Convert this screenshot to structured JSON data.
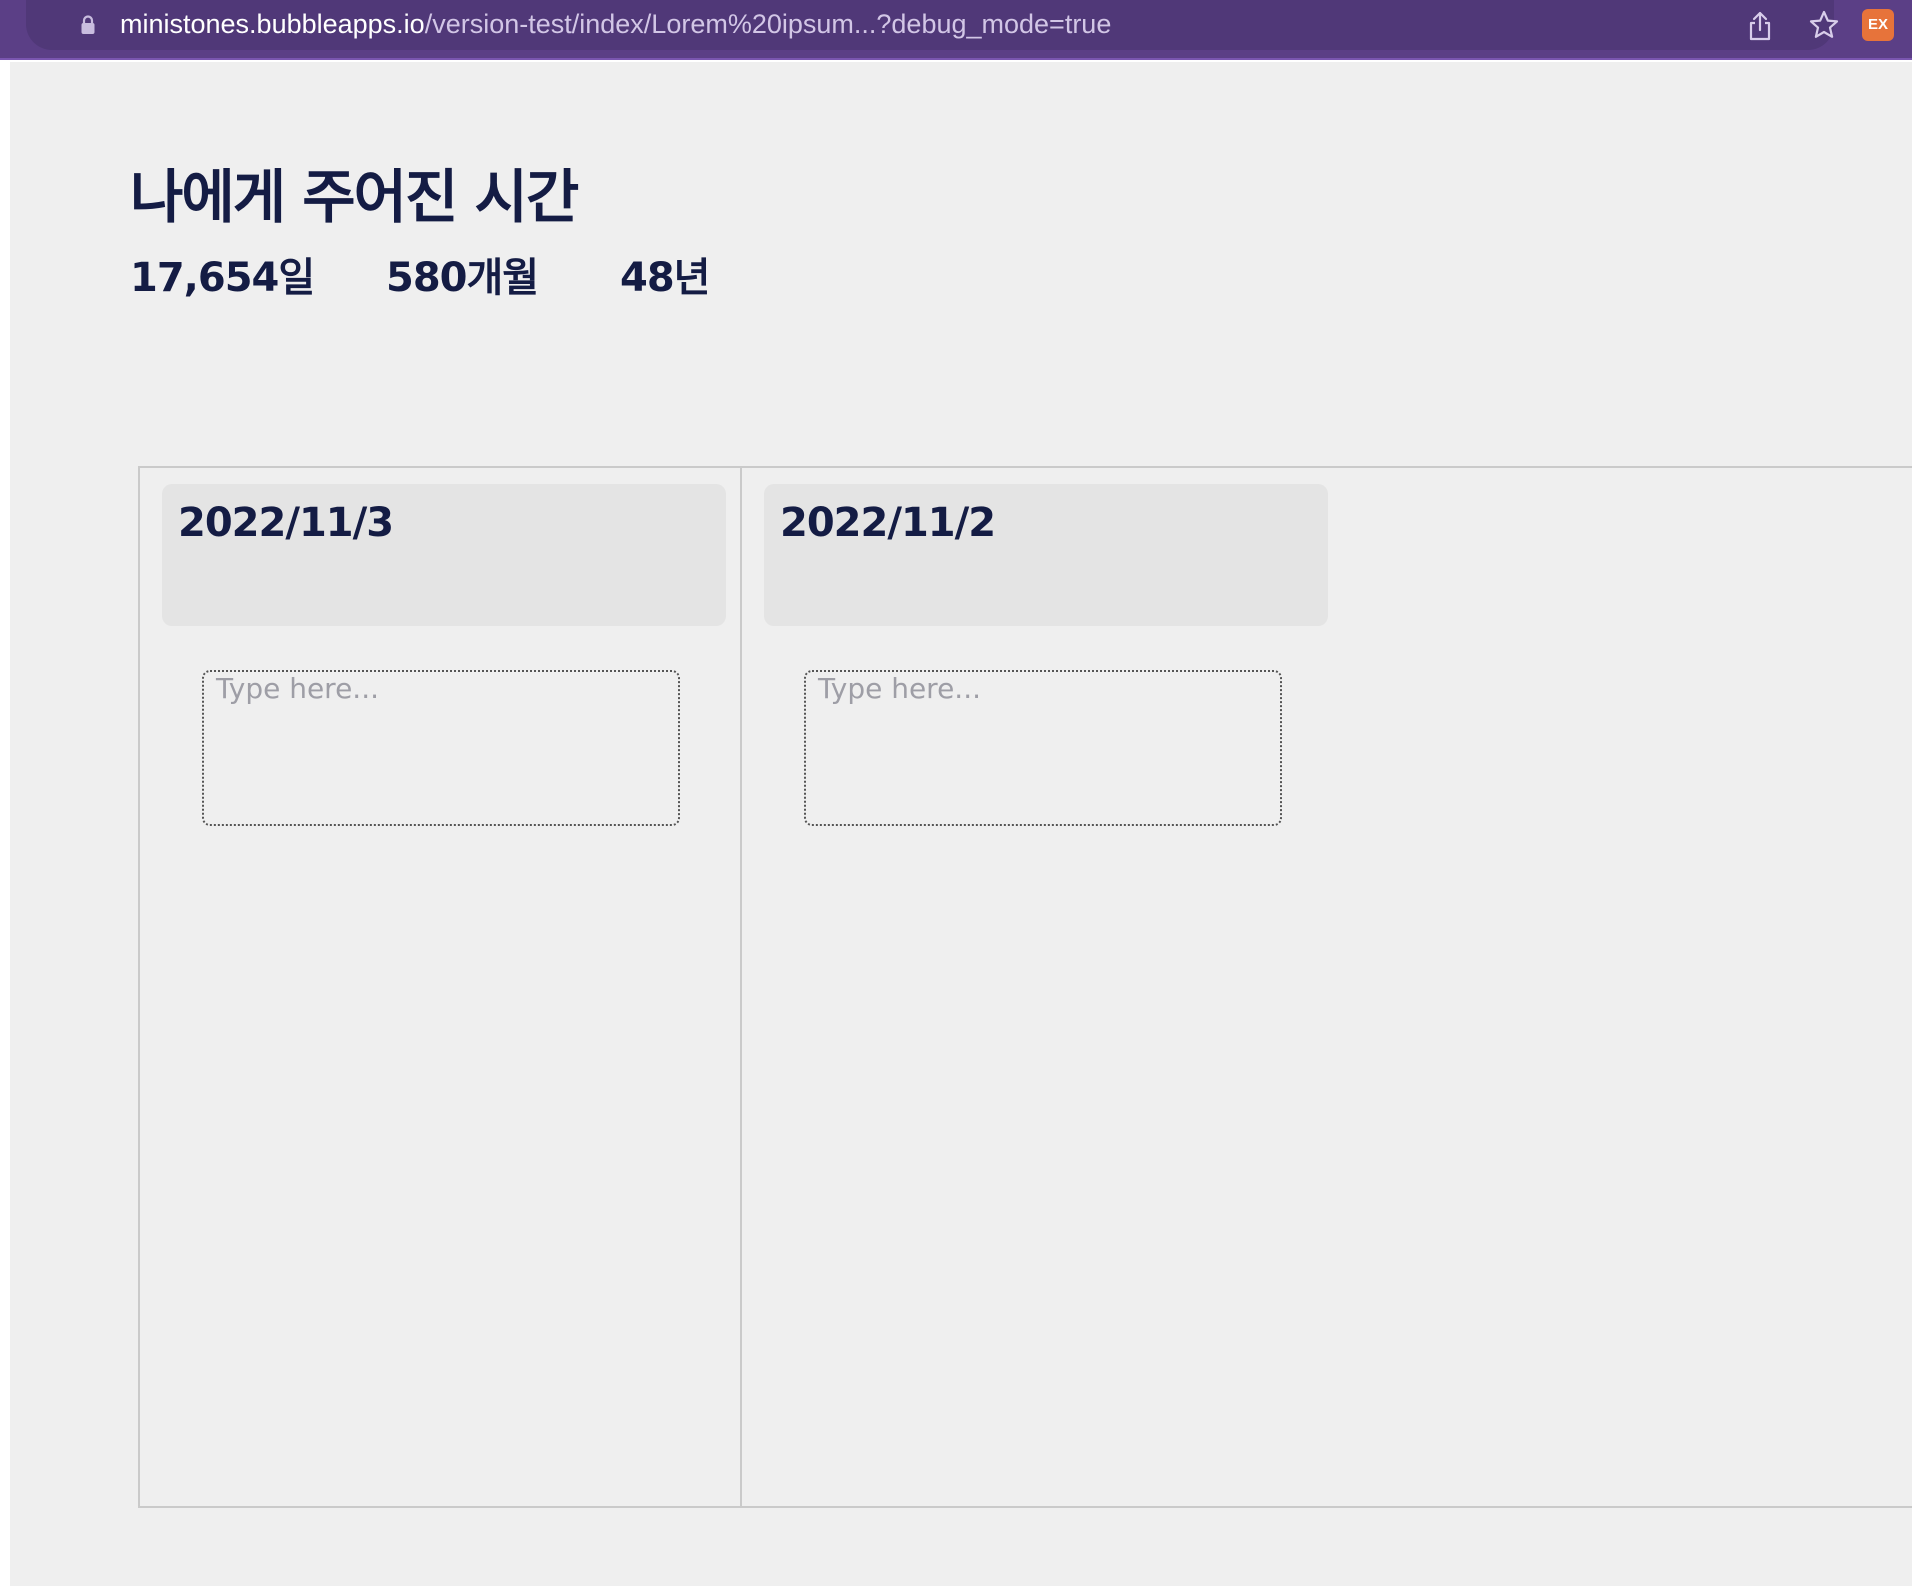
{
  "browser": {
    "url_host": "ministones.bubbleapps.io",
    "url_path": "/version-test/index/Lorem%20ipsum...?debug_mode=true",
    "extension_label": "EX",
    "icons": [
      "lock-icon",
      "share-icon",
      "star-icon",
      "extension-icon"
    ]
  },
  "header": {
    "title": "나에게 주어진 시간",
    "stats": {
      "days": "17,654일",
      "months": "580개월",
      "years": "48년"
    }
  },
  "columns": [
    {
      "date": "2022/11/3",
      "note_placeholder": "Type here..."
    },
    {
      "date": "2022/11/2",
      "note_placeholder": "Type here..."
    }
  ],
  "colors": {
    "browser_bar": "#5b3f86",
    "page_background": "#efefef",
    "text_primary": "#141c44",
    "card_background": "#e4e4e4",
    "extension_badge": "#e7733a"
  }
}
